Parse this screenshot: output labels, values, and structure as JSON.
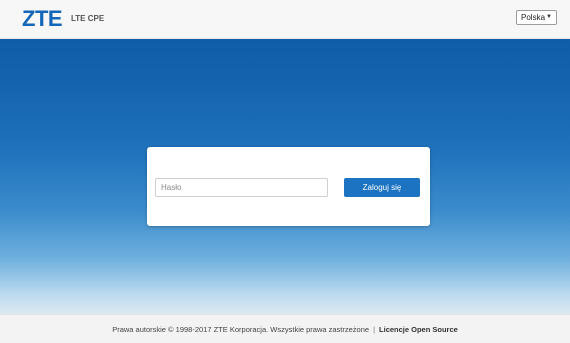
{
  "header": {
    "logo_text": "ZTE",
    "product_name": "LTE CPE",
    "language": {
      "selected": "Polska",
      "arrow_icon": "triangle-down-icon"
    }
  },
  "login": {
    "password_placeholder": "Hasło",
    "password_value": "",
    "submit_label": "Zaloguj się"
  },
  "footer": {
    "copyright": "Prawa autorskie © 1998-2017 ZTE Korporacja. Wszystkie prawa zastrzeżone",
    "separator": "|",
    "open_source_link": "Licencje Open Source"
  },
  "colors": {
    "brand": "#1467b8",
    "button": "#1b73c2",
    "background_top": "#0f5ca8",
    "background_bottom": "#dce9f2"
  }
}
